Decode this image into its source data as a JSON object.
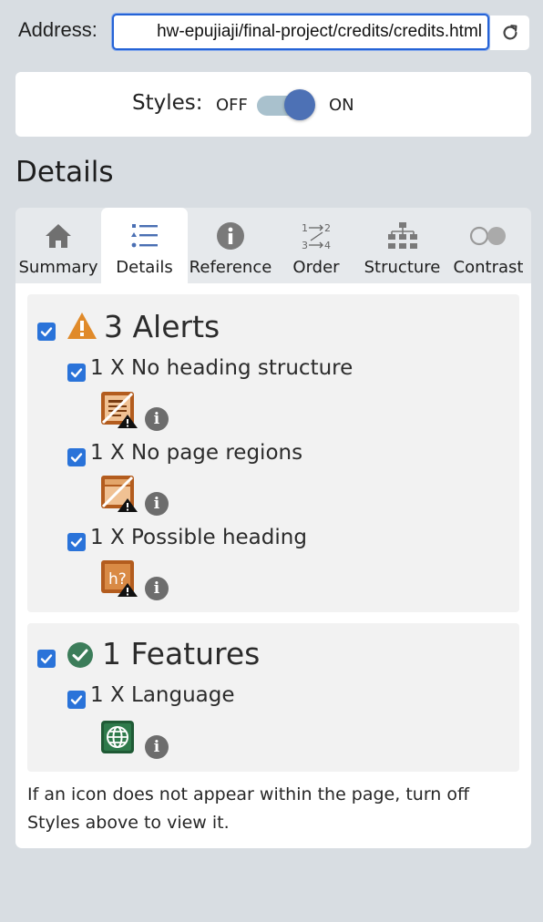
{
  "address": {
    "label": "Address:",
    "value": "hw-epujiaji/final-project/credits/credits.html"
  },
  "styles_toggle": {
    "label": "Styles:",
    "off_label": "OFF",
    "on_label": "ON",
    "state": "on"
  },
  "section": {
    "title": "Details"
  },
  "tabs": [
    {
      "label": "Summary",
      "icon": "home-icon",
      "active": false
    },
    {
      "label": "Details",
      "icon": "list-icon",
      "active": true
    },
    {
      "label": "Reference",
      "icon": "info-icon",
      "active": false
    },
    {
      "label": "Order",
      "icon": "order-icon",
      "active": false
    },
    {
      "label": "Structure",
      "icon": "structure-icon",
      "active": false
    },
    {
      "label": "Contrast",
      "icon": "contrast-icon",
      "active": false
    }
  ],
  "alerts": {
    "title": "3 Alerts",
    "items": [
      {
        "label": "1 X No heading structure",
        "icon": "no-heading-structure-icon"
      },
      {
        "label": "1 X No page regions",
        "icon": "no-page-regions-icon"
      },
      {
        "label": "1 X Possible heading",
        "icon": "possible-heading-icon",
        "icon_text": "h?"
      }
    ]
  },
  "features": {
    "title": "1 Features",
    "items": [
      {
        "label": "1 X Language",
        "icon": "language-globe-icon"
      }
    ]
  },
  "note": "If an icon does not appear within the page, turn off Styles above to view it.",
  "colors": {
    "accent": "#2a73d9",
    "toggle_knob": "#4d71b5",
    "alert_orange": "#e08a2a",
    "feature_green": "#3c7d5a"
  }
}
